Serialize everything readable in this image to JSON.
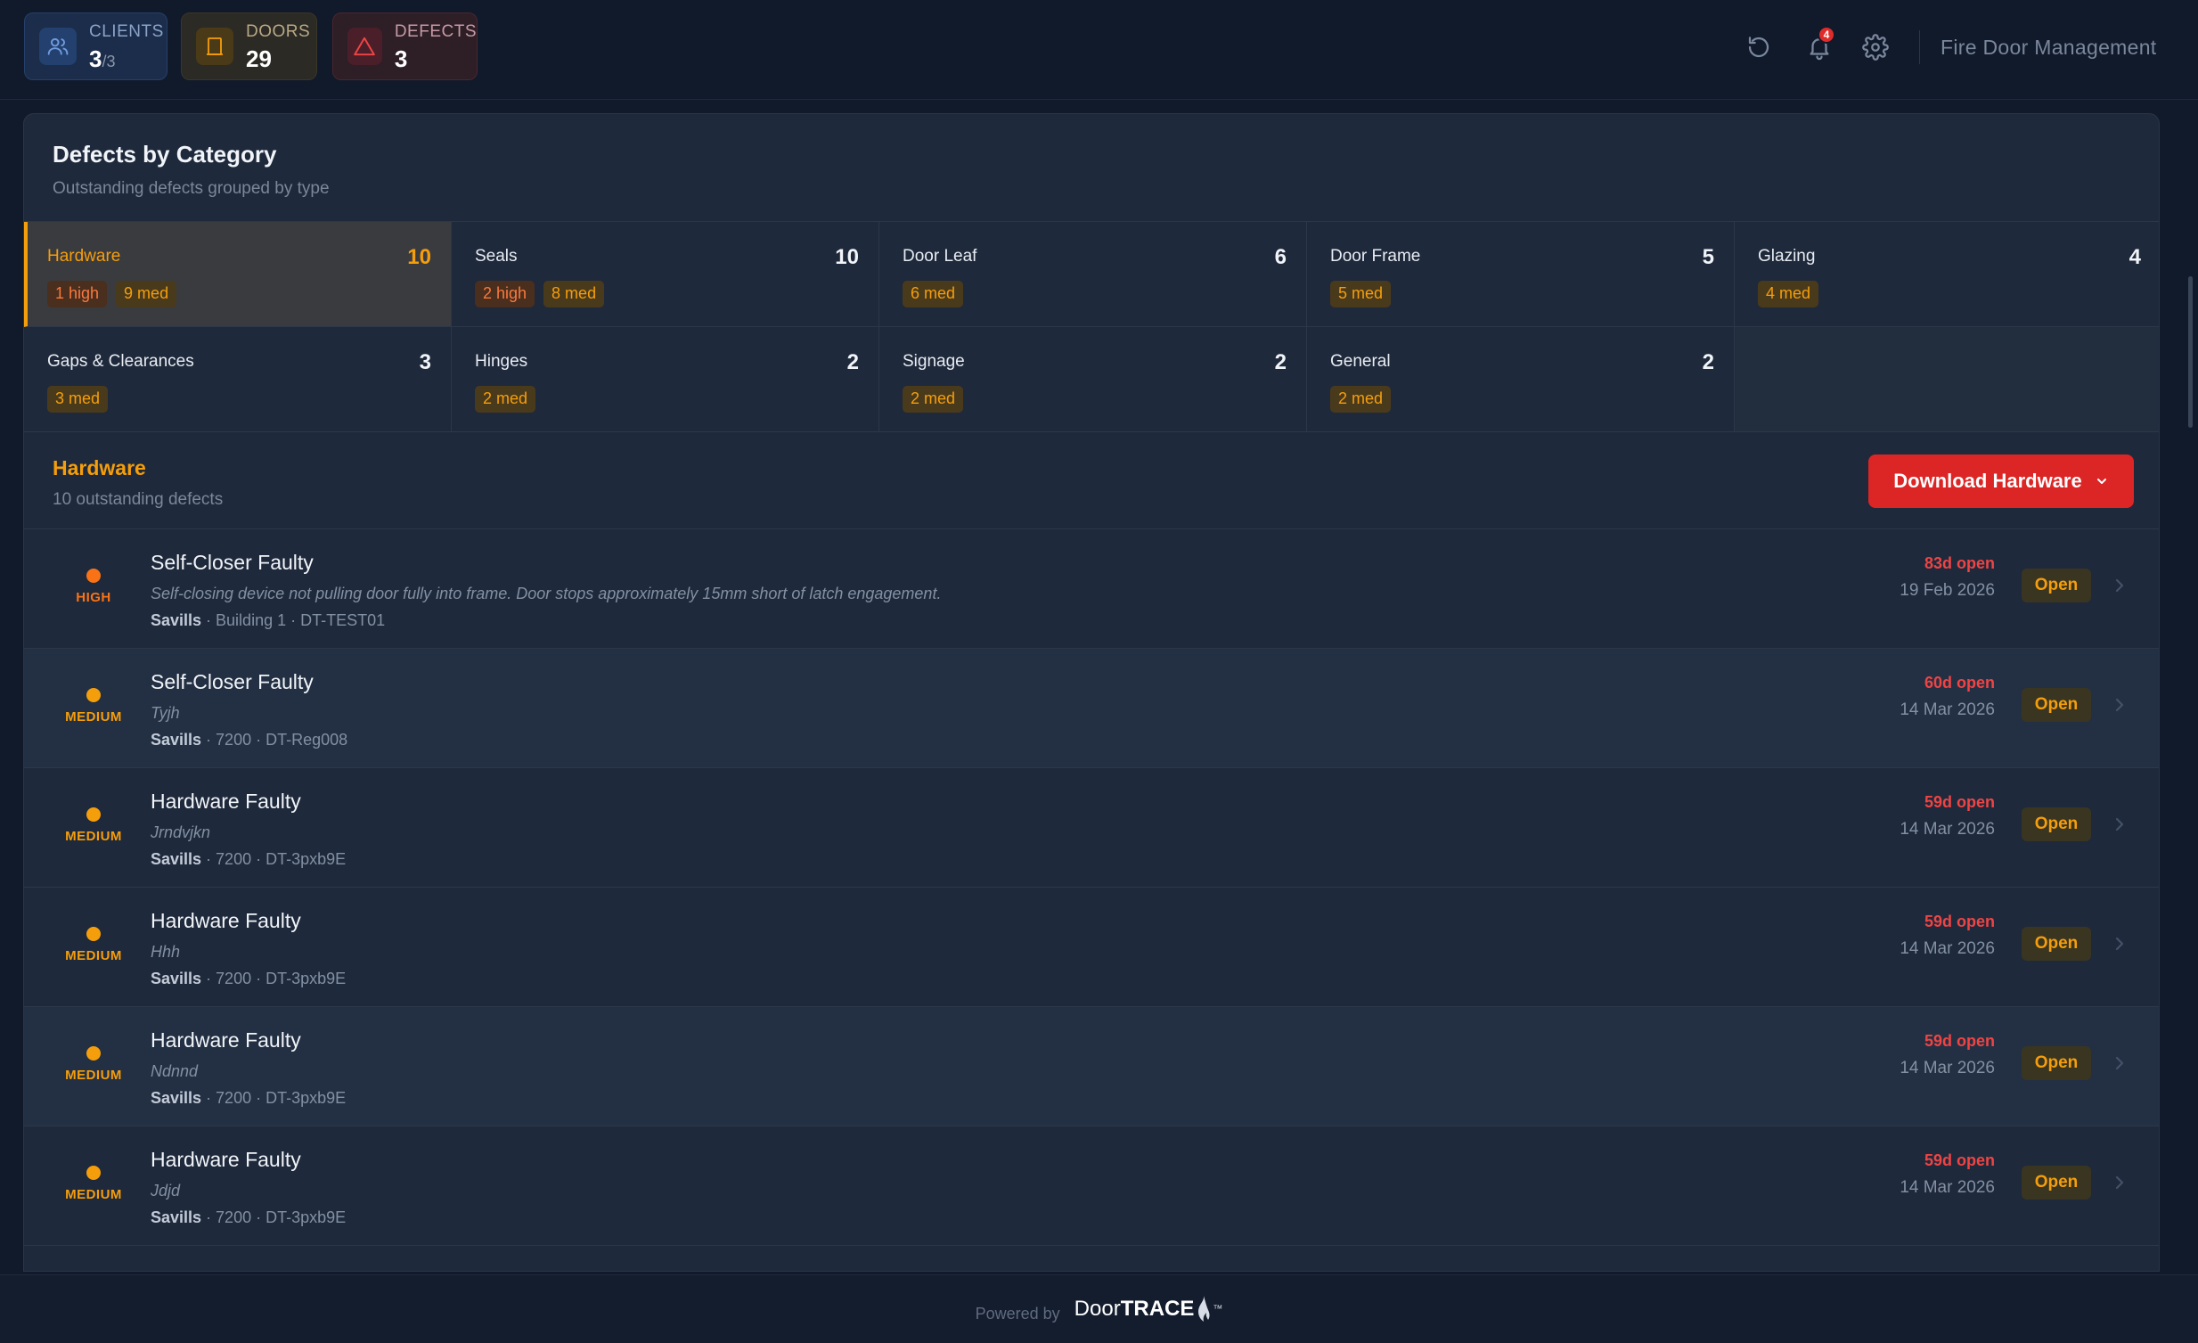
{
  "stats": {
    "clients": {
      "label": "CLIENTS",
      "value": "3",
      "total": "/3"
    },
    "doors": {
      "label": "DOORS",
      "value": "29"
    },
    "defects": {
      "label": "DEFECTS",
      "value": "3"
    }
  },
  "header": {
    "app_title": "Fire Door Management",
    "notification_count": "4"
  },
  "panel": {
    "title": "Defects by Category",
    "subtitle": "Outstanding defects grouped by type"
  },
  "categories": [
    {
      "name": "Hardware",
      "count": "10",
      "high": "1 high",
      "med": "9 med"
    },
    {
      "name": "Seals",
      "count": "10",
      "high": "2 high",
      "med": "8 med"
    },
    {
      "name": "Door Leaf",
      "count": "6",
      "med": "6 med"
    },
    {
      "name": "Door Frame",
      "count": "5",
      "med": "5 med"
    },
    {
      "name": "Glazing",
      "count": "4",
      "med": "4 med"
    },
    {
      "name": "Gaps & Clearances",
      "count": "3",
      "med": "3 med"
    },
    {
      "name": "Hinges",
      "count": "2",
      "med": "2 med"
    },
    {
      "name": "Signage",
      "count": "2",
      "med": "2 med"
    },
    {
      "name": "General",
      "count": "2",
      "med": "2 med"
    }
  ],
  "section": {
    "title": "Hardware",
    "subtitle": "10 outstanding defects",
    "download_label": "Download Hardware"
  },
  "defects": [
    {
      "severity": "HIGH",
      "title": "Self-Closer Faulty",
      "desc": "Self-closing device not pulling door fully into frame. Door stops approximately 15mm short of latch engagement.",
      "client": "Savills",
      "location": " · Building 1 · DT-TEST01",
      "age": "83d open",
      "date": "19 Feb 2026",
      "status": "Open"
    },
    {
      "severity": "MEDIUM",
      "title": "Self-Closer Faulty",
      "desc": "Tyjh",
      "client": "Savills",
      "location": " · 7200 · DT-Reg008",
      "age": "60d open",
      "date": "14 Mar 2026",
      "status": "Open"
    },
    {
      "severity": "MEDIUM",
      "title": "Hardware Faulty",
      "desc": "Jrndvjkn",
      "client": "Savills",
      "location": " · 7200 · DT-3pxb9E",
      "age": "59d open",
      "date": "14 Mar 2026",
      "status": "Open"
    },
    {
      "severity": "MEDIUM",
      "title": "Hardware Faulty",
      "desc": "Hhh",
      "client": "Savills",
      "location": " · 7200 · DT-3pxb9E",
      "age": "59d open",
      "date": "14 Mar 2026",
      "status": "Open"
    },
    {
      "severity": "MEDIUM",
      "title": "Hardware Faulty",
      "desc": "Ndnnd",
      "client": "Savills",
      "location": " · 7200 · DT-3pxb9E",
      "age": "59d open",
      "date": "14 Mar 2026",
      "status": "Open"
    },
    {
      "severity": "MEDIUM",
      "title": "Hardware Faulty",
      "desc": "Jdjd",
      "client": "Savills",
      "location": " · 7200 · DT-3pxb9E",
      "age": "59d open",
      "date": "14 Mar 2026",
      "status": "Open"
    }
  ],
  "footer": {
    "powered_by": "Powered by",
    "brand_a": "Door",
    "brand_b": "TRACE",
    "trademark": "™"
  },
  "colors": {
    "accent": "#f59e0b",
    "danger": "#dc2626",
    "background": "#111a2b",
    "panel": "#1e293b"
  },
  "icons": {
    "clients": "users-icon",
    "doors": "door-icon",
    "defects": "warning-triangle-icon",
    "refresh": "refresh-icon",
    "notifications": "bell-icon",
    "settings": "gear-icon",
    "download": "chevron-down-icon",
    "row": "chevron-right-icon"
  }
}
